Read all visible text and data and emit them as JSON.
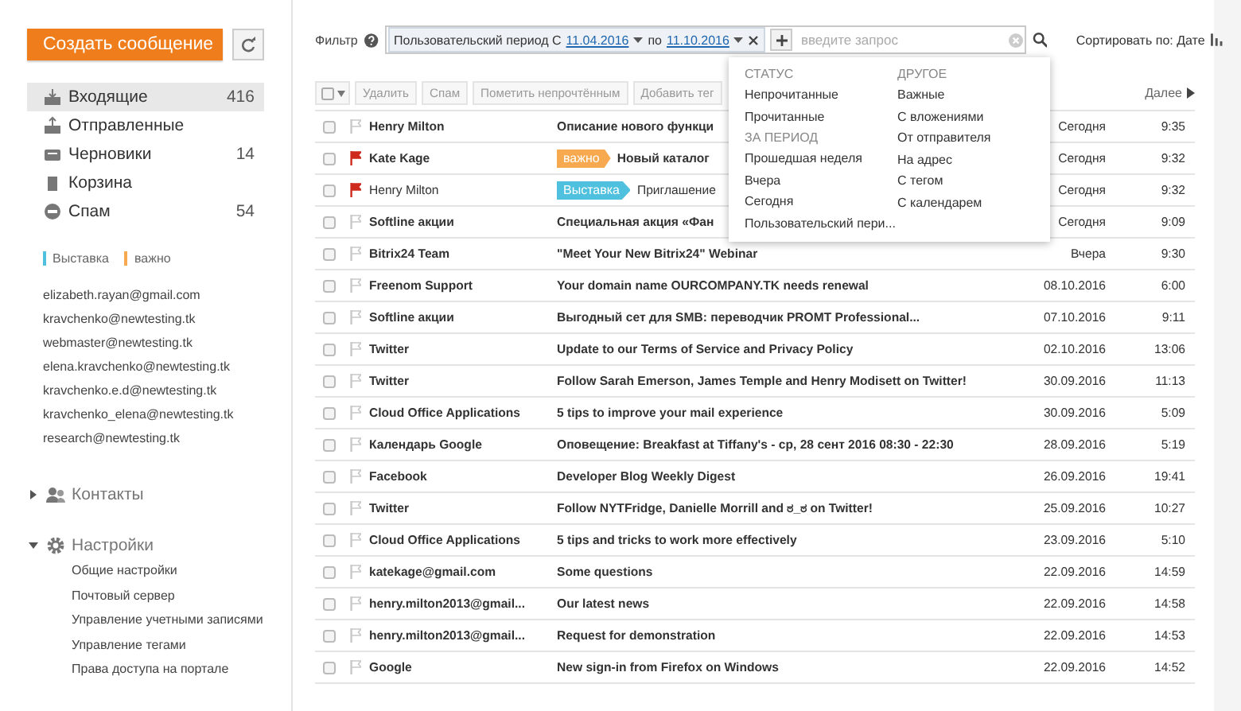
{
  "sidebar": {
    "create_button": "Создать сообщение",
    "folders": [
      {
        "kind": "inbox",
        "label": "Входящие",
        "count": "416",
        "selected": true
      },
      {
        "kind": "sent",
        "label": "Отправленные",
        "selected": false
      },
      {
        "kind": "drafts",
        "label": "Черновики",
        "count": "14",
        "selected": false
      },
      {
        "kind": "trash",
        "label": "Корзина",
        "selected": false
      },
      {
        "kind": "spam",
        "label": "Спам",
        "count": "54",
        "selected": false
      }
    ],
    "tags": [
      {
        "label": "Выставка",
        "color": "#4fc1de"
      },
      {
        "label": "важно",
        "color": "#f7a94f"
      }
    ],
    "mailboxes": [
      "elizabeth.rayan@gmail.com",
      "kravchenko@newtesting.tk",
      "webmaster@newtesting.tk",
      "elena.kravchenko@newtesting.tk",
      "kravchenko.e.d@newtesting.tk",
      "kravchenko_elena@newtesting.tk",
      "research@newtesting.tk"
    ],
    "nav": [
      {
        "kind": "contacts",
        "label": "Контакты",
        "expanded": false
      },
      {
        "kind": "settings",
        "label": "Настройки",
        "expanded": true,
        "children": [
          {
            "label": "Общие настройки"
          },
          {
            "label": "Почтовый сервер"
          },
          {
            "label": "Управление учетными записями"
          },
          {
            "label": "Управление тегами"
          },
          {
            "label": "Права доступа на портале"
          }
        ]
      }
    ]
  },
  "filter": {
    "label": "Фильтр",
    "period_label": "Пользовательский период С",
    "from": "11.04.2016",
    "to_label": "по",
    "to": "11.10.2016",
    "placeholder": "введите запрос",
    "sort": "Сортировать по: Дате"
  },
  "filter_menu": {
    "columns": [
      {
        "sections": [
          {
            "heading": "СТАТУС",
            "items": [
              "Непрочитанные",
              "Прочитанные"
            ]
          },
          {
            "heading": "ЗА ПЕРИОД",
            "items": [
              "Прошедшая неделя",
              "Вчера",
              "Сегодня",
              "Пользовательский пери..."
            ]
          }
        ]
      },
      {
        "sections": [
          {
            "heading": "ДРУГОЕ",
            "items": [
              "Важные",
              "С вложениями",
              "От отправителя",
              "На адрес",
              "С тегом",
              "С календарем"
            ]
          }
        ]
      }
    ]
  },
  "toolbar": {
    "buttons": [
      "Удалить",
      "Спам",
      "Пометить непрочтённым",
      "Добавить тег"
    ],
    "next": "Далее"
  },
  "messages": [
    {
      "sender": "Henry Milton",
      "subject": "Описание нового функци",
      "date": "Сегодня",
      "time": "9:35",
      "unread": true,
      "flagged": false,
      "checked": false
    },
    {
      "sender": "Kate Kage",
      "tag": {
        "label": "важно",
        "color": "#f7a94f"
      },
      "subject": "Новый каталог",
      "date": "Сегодня",
      "time": "9:32",
      "unread": true,
      "flagged": true,
      "checked": false
    },
    {
      "sender": "Henry Milton",
      "tag": {
        "label": "Выставка",
        "color": "#4fc1de"
      },
      "subject": "Приглашение",
      "date": "Сегодня",
      "time": "9:32",
      "unread": false,
      "flagged": true,
      "checked": false
    },
    {
      "sender": "Softline акции",
      "subject": "Специальная акция «Фан",
      "date": "Сегодня",
      "time": "9:09",
      "unread": true,
      "flagged": false,
      "checked": false
    },
    {
      "sender": "Bitrix24 Team",
      "subject": "\"Meet Your New Bitrix24\" Webinar",
      "date": "Вчера",
      "time": "9:30",
      "unread": true,
      "flagged": false,
      "checked": false
    },
    {
      "sender": "Freenom Support",
      "subject": "Your domain name OURCOMPANY.TK needs renewal",
      "date": "08.10.2016",
      "time": "6:00",
      "unread": true,
      "flagged": false,
      "checked": false
    },
    {
      "sender": "Softline акции",
      "subject": "Выгодный сет для SMB: переводчик PROMT Professional...",
      "date": "07.10.2016",
      "time": "9:11",
      "unread": true,
      "flagged": false,
      "checked": false
    },
    {
      "sender": "Twitter",
      "subject": "Update to our Terms of Service and Privacy Policy",
      "date": "02.10.2016",
      "time": "13:06",
      "unread": true,
      "flagged": false,
      "checked": false
    },
    {
      "sender": "Twitter",
      "subject": "Follow Sarah Emerson, James Temple and Henry Modisett on Twitter!",
      "date": "30.09.2016",
      "time": "11:13",
      "unread": true,
      "flagged": false,
      "checked": false
    },
    {
      "sender": "Cloud Office Applications",
      "subject": "5 tips to improve your mail experience",
      "date": "30.09.2016",
      "time": "5:09",
      "unread": true,
      "flagged": false,
      "checked": false
    },
    {
      "sender": "Календарь Google",
      "subject": "Оповещение: Breakfast at Tiffany's - ср, 28 сент 2016 08:30 - 22:30",
      "date": "28.09.2016",
      "time": "5:19",
      "unread": true,
      "flagged": false,
      "checked": false
    },
    {
      "sender": "Facebook",
      "subject": "Developer Blog Weekly Digest",
      "date": "26.09.2016",
      "time": "19:41",
      "unread": true,
      "flagged": false,
      "checked": false
    },
    {
      "sender": "Twitter",
      "subject": "Follow NYTFridge, Danielle Morrill and ಠ_ಠ on Twitter!",
      "date": "25.09.2016",
      "time": "10:27",
      "unread": true,
      "flagged": false,
      "checked": false
    },
    {
      "sender": "Cloud Office Applications",
      "subject": "5 tips and tricks to work more effectively",
      "date": "23.09.2016",
      "time": "5:10",
      "unread": true,
      "flagged": false,
      "checked": false
    },
    {
      "sender": "katekage@gmail.com",
      "subject": "Some questions",
      "date": "22.09.2016",
      "time": "14:59",
      "unread": true,
      "flagged": false,
      "checked": false
    },
    {
      "sender": "henry.milton2013@gmail...",
      "subject": "Our latest news",
      "date": "22.09.2016",
      "time": "14:58",
      "unread": true,
      "flagged": false,
      "checked": false
    },
    {
      "sender": "henry.milton2013@gmail...",
      "subject": "Request for demonstration",
      "date": "22.09.2016",
      "time": "14:53",
      "unread": true,
      "flagged": false,
      "checked": false
    },
    {
      "sender": "Google",
      "subject": "New sign-in from Firefox on Windows",
      "date": "22.09.2016",
      "time": "14:52",
      "unread": true,
      "flagged": false,
      "checked": false
    }
  ]
}
